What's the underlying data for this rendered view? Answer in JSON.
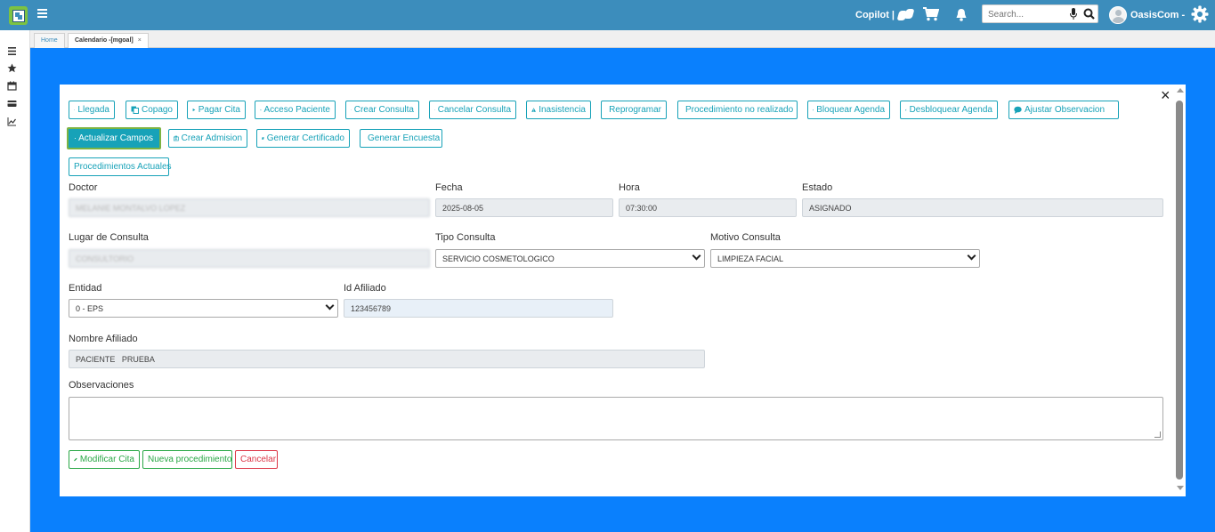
{
  "topbar": {
    "copilot_label": "Copilot |",
    "search_placeholder": "Search...",
    "user_name": "OasisCom -"
  },
  "tabs": [
    {
      "label": "Home"
    },
    {
      "label": "Calendario -[mgoal]",
      "close": "×"
    }
  ],
  "toolbar_row1": [
    {
      "label": "Llegada",
      "icon": "caret-down-icon"
    },
    {
      "label": "Copago",
      "icon": "copy-icon"
    },
    {
      "label": "Pagar Cita",
      "icon": "play-icon"
    },
    {
      "label": "Acceso Paciente",
      "icon": "cart-icon"
    },
    {
      "label": "Crear Consulta",
      "icon": "plus-icon"
    },
    {
      "label": "Cancelar Consulta",
      "icon": "ban-icon"
    },
    {
      "label": "Inasistencia",
      "icon": "warning-icon"
    },
    {
      "label": "Reprogramar",
      "icon": "caret-up-icon"
    },
    {
      "label": "Procedimiento no realizado",
      "icon": "double-up-icon"
    },
    {
      "label": "Bloquear Agenda",
      "icon": "lock-icon"
    },
    {
      "label": "Desbloquear Agenda",
      "icon": "unlock-icon"
    },
    {
      "label": "Ajustar Observacion",
      "icon": "comment-icon"
    }
  ],
  "toolbar_row2": [
    {
      "label": "Actualizar Campos",
      "icon": "edit-icon"
    },
    {
      "label": "Crear Admision",
      "icon": "medkit-icon"
    },
    {
      "label": "Generar Certificado",
      "icon": "book-icon"
    },
    {
      "label": "Generar Encuesta",
      "icon": "bookmark-icon"
    }
  ],
  "toolbar_row3": [
    {
      "label": "Procedimientos Actuales"
    }
  ],
  "form": {
    "doctor_label": "Doctor",
    "doctor_value": "MELANIE MONTALVO LOPEZ",
    "fecha_label": "Fecha",
    "fecha_value": "2025-08-05",
    "hora_label": "Hora",
    "hora_value": "07:30:00",
    "estado_label": "Estado",
    "estado_value": "ASIGNADO",
    "lugar_label": "Lugar de Consulta",
    "lugar_value": "CONSULTORIO",
    "tipo_label": "Tipo Consulta",
    "tipo_value": "SERVICIO COSMETOLOGICO",
    "motivo_label": "Motivo Consulta",
    "motivo_value": "LIMPIEZA FACIAL",
    "entidad_label": "Entidad",
    "entidad_value": "0 - EPS",
    "idafiliado_label": "Id Afiliado",
    "idafiliado_value": "123456789",
    "nombre_label": "Nombre Afiliado",
    "nombre_value": "PACIENTE   PRUEBA",
    "obs_label": "Observaciones",
    "obs_value": ""
  },
  "footer_buttons": {
    "modificar": "Modificar Cita",
    "nueva": "Nueva procedimiento",
    "cancelar": "Cancelar"
  },
  "colors": {
    "topbar": "#3c8dbc",
    "background": "#0a80fd",
    "accent": "#17a2b8",
    "success": "#28a745",
    "danger": "#dc3545"
  }
}
